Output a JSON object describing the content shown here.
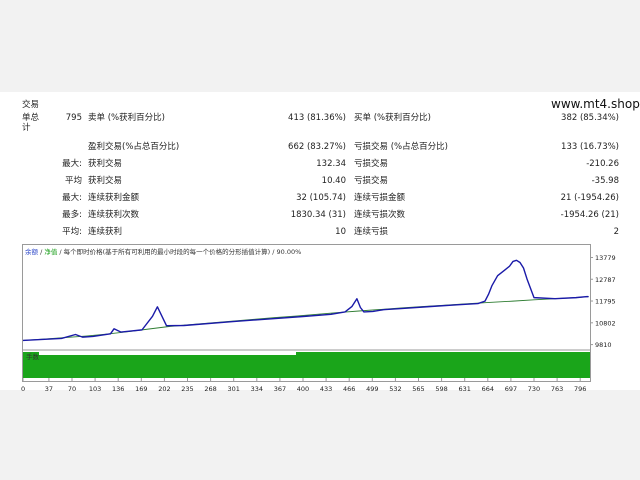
{
  "brand": "www.mt4.shop",
  "stats": {
    "trades_label": "交易",
    "total_label": "单总\n计",
    "total_trades": "795",
    "short_label": "卖单 (%获利百分比)",
    "short_value": "413 (81.36%)",
    "long_label": "买单 (%获利百分比)",
    "long_value": "382 (85.34%)",
    "profit_trades_label": "盈利交易(%占总百分比)",
    "profit_trades_value": "662 (83.27%)",
    "loss_trades_label": "亏损交易 (%占总百分比)",
    "loss_trades_value": "133 (16.73%)",
    "largest_label": "最大:",
    "largest_profit_label": "获利交易",
    "largest_profit_value": "132.34",
    "largest_loss_label": "亏损交易",
    "largest_loss_value": "-210.26",
    "average_label": "平均",
    "average_profit_label": "获利交易",
    "average_profit_value": "10.40",
    "average_loss_label": "亏损交易",
    "average_loss_value": "-35.98",
    "max1_label": "最大:",
    "max_consec_wins_amt_label": "连续获利金额",
    "max_consec_wins_amt_value": "32 (105.74)",
    "max_consec_losses_amt_label": "连续亏损金额",
    "max_consec_losses_amt_value": "21 (-1954.26)",
    "max2_label": "最多:",
    "max_consec_profit_count_label": "连续获利次数",
    "max_consec_profit_count_value": "1830.34 (31)",
    "max_consec_loss_count_label": "连续亏损次数",
    "max_consec_loss_count_value": "-1954.26 (21)",
    "avg2_label": "平均:",
    "avg_consec_wins_label": "连续获利",
    "avg_consec_wins_value": "10",
    "avg_consec_losses_label": "连续亏损",
    "avg_consec_losses_value": "2"
  },
  "legend": {
    "balance": "余额",
    "sep1": " / ",
    "equity": "净值",
    "text": " / 每个即时价格(基于所有可利用的最小时段的每一个价格的分形插值计算) / 90.00%",
    "volume_label": "手数"
  },
  "colors": {
    "balance": "#1a1aa8",
    "equity": "#2e7d32",
    "volume": "#1aa51a"
  },
  "chart_data": {
    "type": "line",
    "x_ticks": [
      0,
      37,
      70,
      103,
      136,
      169,
      202,
      235,
      268,
      301,
      334,
      367,
      400,
      433,
      466,
      499,
      532,
      565,
      598,
      631,
      664,
      697,
      730,
      763,
      796
    ],
    "y_ticks": [
      9810,
      10802,
      11795,
      12787,
      13779
    ],
    "xlim": [
      0,
      810
    ],
    "ylim": [
      9700,
      14120
    ],
    "series": [
      {
        "name": "余额",
        "x": [
          0,
          30,
          60,
          90,
          120,
          150,
          180,
          210,
          240,
          270,
          300,
          330,
          360,
          390,
          420,
          450,
          480,
          510,
          540,
          570,
          600,
          630,
          660,
          700,
          730,
          760,
          790,
          808
        ],
        "y": [
          10000,
          10060,
          10130,
          10200,
          10290,
          10400,
          10520,
          10640,
          10720,
          10800,
          10880,
          10960,
          11040,
          11110,
          11190,
          11270,
          11340,
          11410,
          11480,
          11540,
          11600,
          11660,
          11720,
          11790,
          11850,
          11900,
          11950,
          12000
        ]
      },
      {
        "name": "净值",
        "x": [
          0,
          55,
          75,
          85,
          100,
          125,
          130,
          140,
          170,
          185,
          192,
          200,
          205,
          230,
          300,
          400,
          440,
          460,
          470,
          477,
          482,
          487,
          500,
          515,
          520,
          540,
          580,
          620,
          650,
          660,
          665,
          670,
          678,
          688,
          695,
          700,
          705,
          710,
          715,
          720,
          730,
          760,
          790,
          806,
          808
        ],
        "y": [
          10000,
          10090,
          10270,
          10150,
          10180,
          10300,
          10530,
          10380,
          10480,
          11100,
          11530,
          11000,
          10670,
          10680,
          10860,
          11090,
          11190,
          11300,
          11550,
          11900,
          11500,
          11300,
          11320,
          11400,
          11410,
          11450,
          11540,
          11620,
          11680,
          11790,
          12100,
          12500,
          12950,
          13200,
          13380,
          13600,
          13650,
          13550,
          13300,
          12800,
          11950,
          11900,
          11950,
          12000,
          11990
        ]
      }
    ]
  }
}
